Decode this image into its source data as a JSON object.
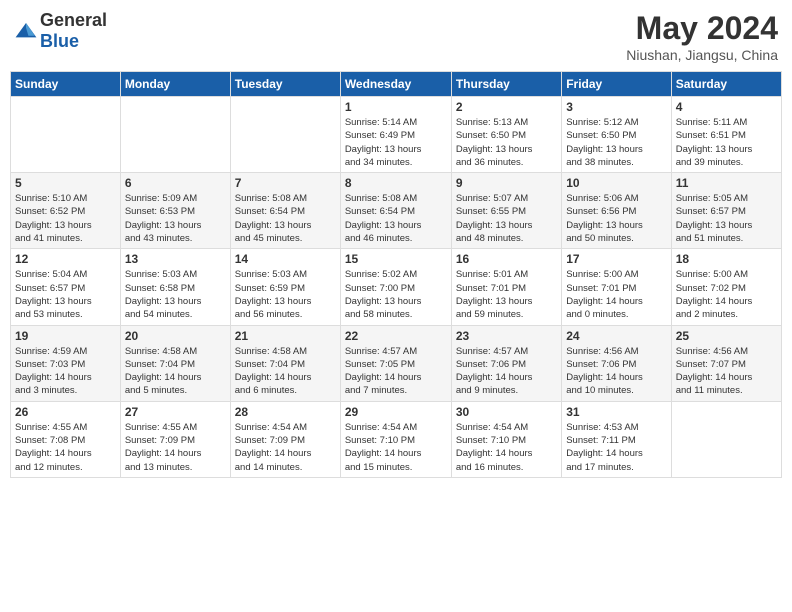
{
  "logo": {
    "general": "General",
    "blue": "Blue"
  },
  "title": "May 2024",
  "location": "Niushan, Jiangsu, China",
  "weekdays": [
    "Sunday",
    "Monday",
    "Tuesday",
    "Wednesday",
    "Thursday",
    "Friday",
    "Saturday"
  ],
  "weeks": [
    [
      {
        "day": "",
        "info": ""
      },
      {
        "day": "",
        "info": ""
      },
      {
        "day": "",
        "info": ""
      },
      {
        "day": "1",
        "info": "Sunrise: 5:14 AM\nSunset: 6:49 PM\nDaylight: 13 hours\nand 34 minutes."
      },
      {
        "day": "2",
        "info": "Sunrise: 5:13 AM\nSunset: 6:50 PM\nDaylight: 13 hours\nand 36 minutes."
      },
      {
        "day": "3",
        "info": "Sunrise: 5:12 AM\nSunset: 6:50 PM\nDaylight: 13 hours\nand 38 minutes."
      },
      {
        "day": "4",
        "info": "Sunrise: 5:11 AM\nSunset: 6:51 PM\nDaylight: 13 hours\nand 39 minutes."
      }
    ],
    [
      {
        "day": "5",
        "info": "Sunrise: 5:10 AM\nSunset: 6:52 PM\nDaylight: 13 hours\nand 41 minutes."
      },
      {
        "day": "6",
        "info": "Sunrise: 5:09 AM\nSunset: 6:53 PM\nDaylight: 13 hours\nand 43 minutes."
      },
      {
        "day": "7",
        "info": "Sunrise: 5:08 AM\nSunset: 6:54 PM\nDaylight: 13 hours\nand 45 minutes."
      },
      {
        "day": "8",
        "info": "Sunrise: 5:08 AM\nSunset: 6:54 PM\nDaylight: 13 hours\nand 46 minutes."
      },
      {
        "day": "9",
        "info": "Sunrise: 5:07 AM\nSunset: 6:55 PM\nDaylight: 13 hours\nand 48 minutes."
      },
      {
        "day": "10",
        "info": "Sunrise: 5:06 AM\nSunset: 6:56 PM\nDaylight: 13 hours\nand 50 minutes."
      },
      {
        "day": "11",
        "info": "Sunrise: 5:05 AM\nSunset: 6:57 PM\nDaylight: 13 hours\nand 51 minutes."
      }
    ],
    [
      {
        "day": "12",
        "info": "Sunrise: 5:04 AM\nSunset: 6:57 PM\nDaylight: 13 hours\nand 53 minutes."
      },
      {
        "day": "13",
        "info": "Sunrise: 5:03 AM\nSunset: 6:58 PM\nDaylight: 13 hours\nand 54 minutes."
      },
      {
        "day": "14",
        "info": "Sunrise: 5:03 AM\nSunset: 6:59 PM\nDaylight: 13 hours\nand 56 minutes."
      },
      {
        "day": "15",
        "info": "Sunrise: 5:02 AM\nSunset: 7:00 PM\nDaylight: 13 hours\nand 58 minutes."
      },
      {
        "day": "16",
        "info": "Sunrise: 5:01 AM\nSunset: 7:01 PM\nDaylight: 13 hours\nand 59 minutes."
      },
      {
        "day": "17",
        "info": "Sunrise: 5:00 AM\nSunset: 7:01 PM\nDaylight: 14 hours\nand 0 minutes."
      },
      {
        "day": "18",
        "info": "Sunrise: 5:00 AM\nSunset: 7:02 PM\nDaylight: 14 hours\nand 2 minutes."
      }
    ],
    [
      {
        "day": "19",
        "info": "Sunrise: 4:59 AM\nSunset: 7:03 PM\nDaylight: 14 hours\nand 3 minutes."
      },
      {
        "day": "20",
        "info": "Sunrise: 4:58 AM\nSunset: 7:04 PM\nDaylight: 14 hours\nand 5 minutes."
      },
      {
        "day": "21",
        "info": "Sunrise: 4:58 AM\nSunset: 7:04 PM\nDaylight: 14 hours\nand 6 minutes."
      },
      {
        "day": "22",
        "info": "Sunrise: 4:57 AM\nSunset: 7:05 PM\nDaylight: 14 hours\nand 7 minutes."
      },
      {
        "day": "23",
        "info": "Sunrise: 4:57 AM\nSunset: 7:06 PM\nDaylight: 14 hours\nand 9 minutes."
      },
      {
        "day": "24",
        "info": "Sunrise: 4:56 AM\nSunset: 7:06 PM\nDaylight: 14 hours\nand 10 minutes."
      },
      {
        "day": "25",
        "info": "Sunrise: 4:56 AM\nSunset: 7:07 PM\nDaylight: 14 hours\nand 11 minutes."
      }
    ],
    [
      {
        "day": "26",
        "info": "Sunrise: 4:55 AM\nSunset: 7:08 PM\nDaylight: 14 hours\nand 12 minutes."
      },
      {
        "day": "27",
        "info": "Sunrise: 4:55 AM\nSunset: 7:09 PM\nDaylight: 14 hours\nand 13 minutes."
      },
      {
        "day": "28",
        "info": "Sunrise: 4:54 AM\nSunset: 7:09 PM\nDaylight: 14 hours\nand 14 minutes."
      },
      {
        "day": "29",
        "info": "Sunrise: 4:54 AM\nSunset: 7:10 PM\nDaylight: 14 hours\nand 15 minutes."
      },
      {
        "day": "30",
        "info": "Sunrise: 4:54 AM\nSunset: 7:10 PM\nDaylight: 14 hours\nand 16 minutes."
      },
      {
        "day": "31",
        "info": "Sunrise: 4:53 AM\nSunset: 7:11 PM\nDaylight: 14 hours\nand 17 minutes."
      },
      {
        "day": "",
        "info": ""
      }
    ]
  ]
}
